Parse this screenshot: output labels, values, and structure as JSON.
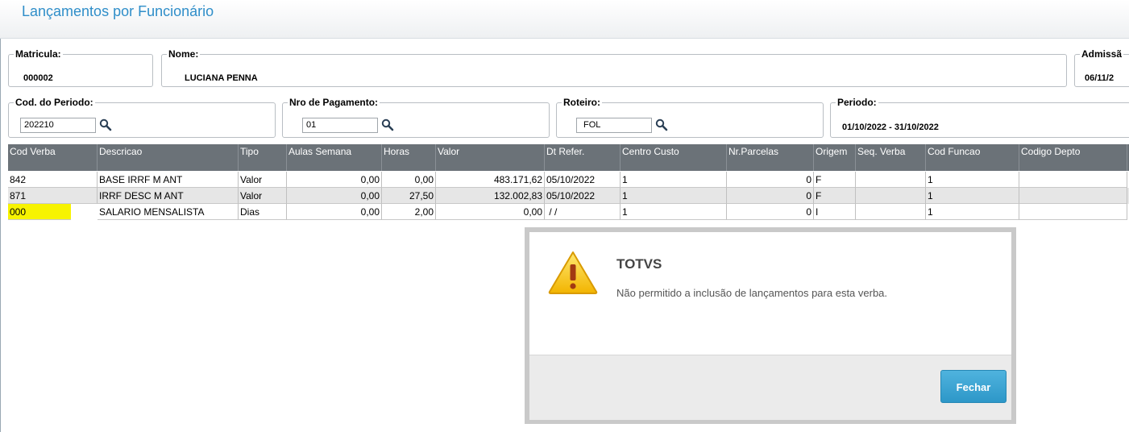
{
  "window": {
    "title": "Lançamentos por Funcionário"
  },
  "fields": {
    "matricula": {
      "label": "Matricula:",
      "value": "000002"
    },
    "nome": {
      "label": "Nome:",
      "value": "LUCIANA PENNA"
    },
    "admissao": {
      "label": "Admissã",
      "value": "06/11/2"
    },
    "cod_periodo": {
      "label": "Cod. do Periodo:",
      "value": "202210"
    },
    "nro_pagamento": {
      "label": "Nro de Pagamento:",
      "value": "01"
    },
    "roteiro": {
      "label": "Roteiro:",
      "value": "FOL"
    },
    "periodo": {
      "label": "Periodo:",
      "value": "01/10/2022 - 31/10/2022"
    }
  },
  "grid": {
    "headers": [
      "Cod Verba",
      "Descricao",
      "Tipo",
      "Aulas Semana",
      "Horas",
      "Valor",
      "Dt Refer.",
      "Centro Custo",
      "Nr.Parcelas",
      "Origem",
      "Seq. Verba",
      "Cod Funcao",
      "Codigo Depto"
    ],
    "rows": [
      [
        "842",
        "BASE IRRF M ANT",
        "Valor",
        "0,00",
        "0,00",
        "483.171,62",
        "05/10/2022",
        "1",
        "0",
        "F",
        "",
        "1",
        ""
      ],
      [
        "871",
        "IRRF DESC M ANT",
        "Valor",
        "0,00",
        "27,50",
        "132.002,83",
        "05/10/2022",
        "1",
        "0",
        "F",
        "",
        "1",
        ""
      ],
      [
        "000",
        "SALARIO MENSALISTA",
        "Dias",
        "0,00",
        "2,00",
        "0,00",
        " / /",
        "1",
        "0",
        "I",
        "",
        "1",
        ""
      ]
    ]
  },
  "dialog": {
    "title": "TOTVS",
    "message": "Não permitido a inclusão de lançamentos para esta verba.",
    "button": "Fechar",
    "icon": "warning-icon"
  },
  "colors": {
    "accent": "#2f8ec9",
    "header_bg": "#6b7278",
    "highlight": "#f7f300",
    "button": "#2d97c8"
  }
}
